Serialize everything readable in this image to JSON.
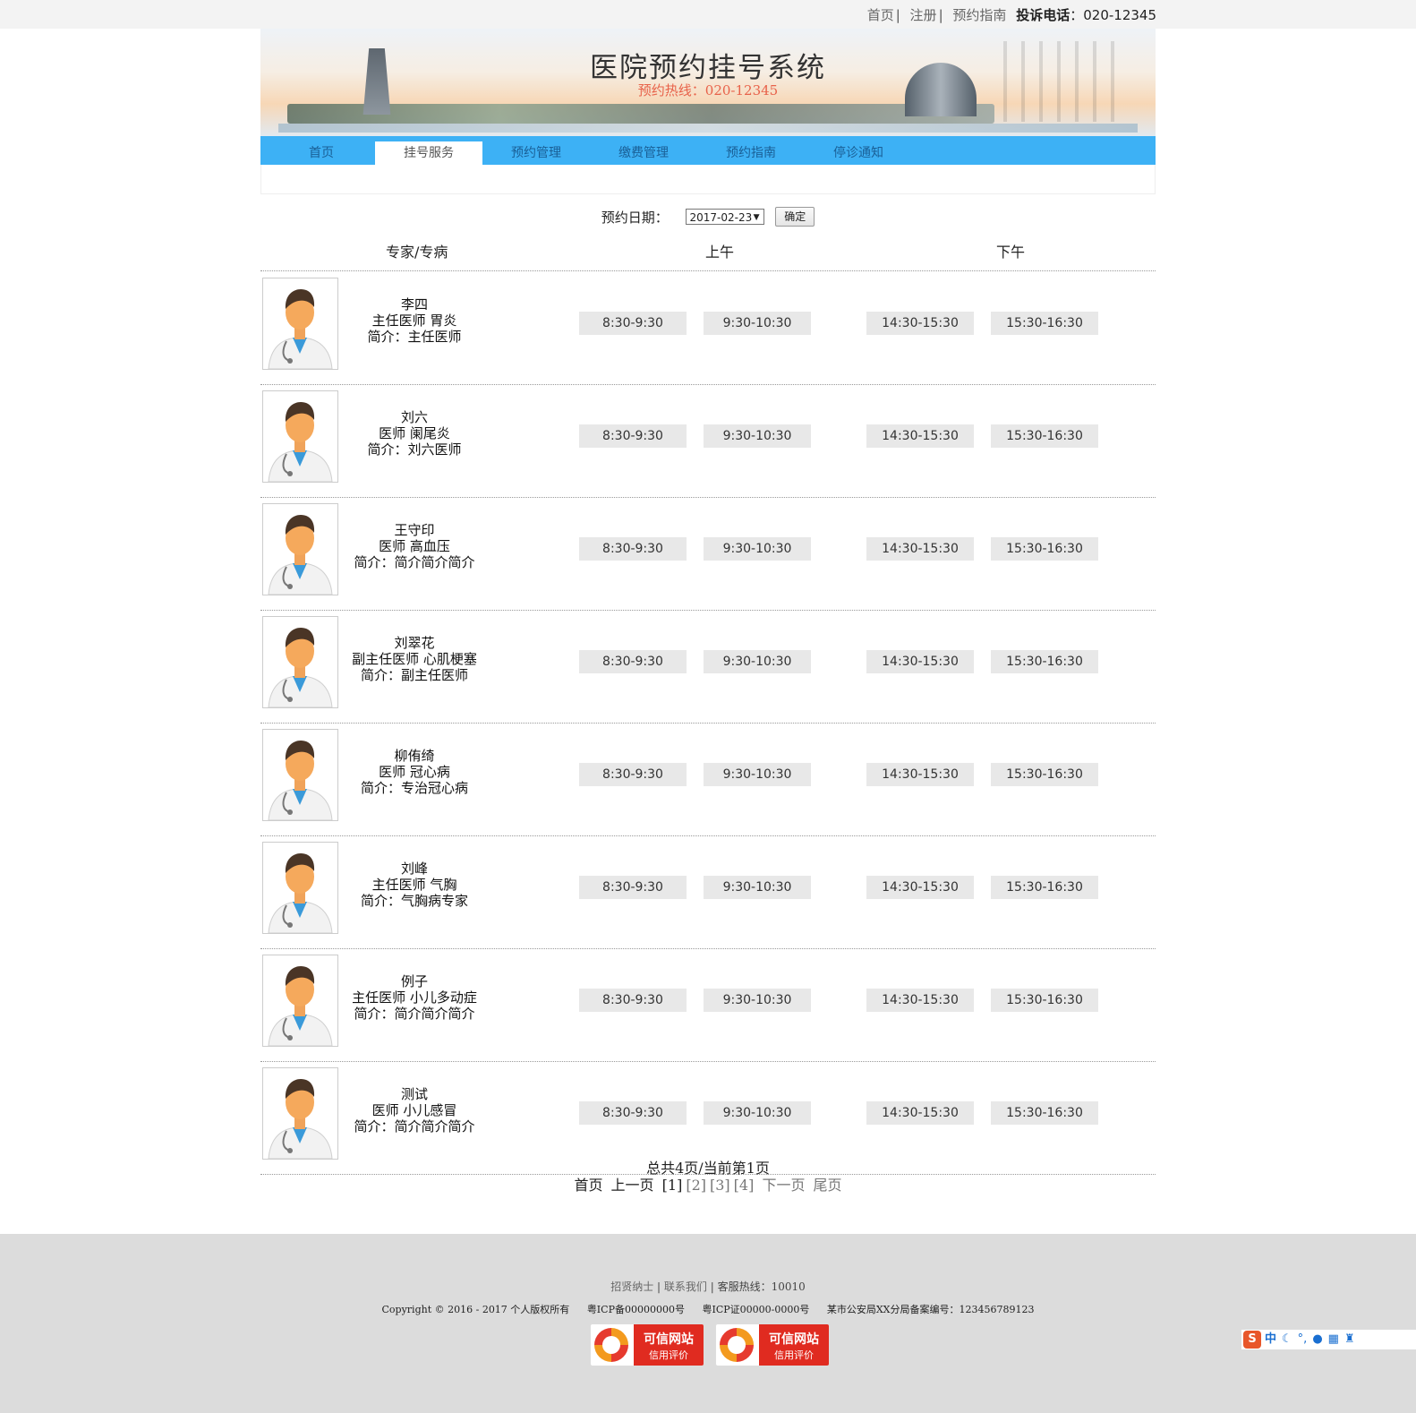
{
  "top_links": {
    "home": "首页",
    "register": "注册",
    "guide": "预约指南",
    "complaint_label": "投诉电话",
    "complaint_phone": "020-12345"
  },
  "banner": {
    "title": "医院预约挂号系统",
    "hotline": "预约热线：020-12345"
  },
  "nav": {
    "tabs": [
      {
        "label": "首页",
        "active": false
      },
      {
        "label": "挂号服务",
        "active": true
      },
      {
        "label": "预约管理",
        "active": false
      },
      {
        "label": "缴费管理",
        "active": false
      },
      {
        "label": "预约指南",
        "active": false
      },
      {
        "label": "停诊通知",
        "active": false
      }
    ]
  },
  "date_filter": {
    "label": "预约日期：",
    "selected": "2017-02-23",
    "confirm": "确定"
  },
  "table_header": {
    "expert": "专家/专病",
    "morning": "上午",
    "afternoon": "下午"
  },
  "slots": [
    "8:30-9:30",
    "9:30-10:30",
    "14:30-15:30",
    "15:30-16:30"
  ],
  "doctors": [
    {
      "name": "李四",
      "title_line": "主任医师  胃炎",
      "intro": "简介：主任医师"
    },
    {
      "name": "刘六",
      "title_line": "医师  阑尾炎",
      "intro": "简介：刘六医师"
    },
    {
      "name": "王守印",
      "title_line": "医师  高血压",
      "intro": "简介：简介简介简介"
    },
    {
      "name": "刘翠花",
      "title_line": "副主任医师  心肌梗塞",
      "intro": "简介：副主任医师"
    },
    {
      "name": "柳侑绮",
      "title_line": "医师  冠心病",
      "intro": "简介：专治冠心病"
    },
    {
      "name": "刘峰",
      "title_line": "主任医师  气胸",
      "intro": "简介：气胸病专家"
    },
    {
      "name": "例子",
      "title_line": "主任医师  小儿多动症",
      "intro": "简介：简介简介简介"
    },
    {
      "name": "测试",
      "title_line": "医师  小儿感冒",
      "intro": "简介：简介简介简介"
    }
  ],
  "pager": {
    "summary": "总共4页/当前第1页",
    "first": "首页",
    "prev": "上一页",
    "pages": [
      "[1]",
      "[2]",
      "[3]",
      "[4]"
    ],
    "next": "下一页",
    "last": "尾页"
  },
  "footer": {
    "link1": "招贤纳士",
    "link2": "联系我们",
    "service": "客服热线：10010",
    "copyright": "Copyright © 2016 - 2017 个人版权所有",
    "icp1": "粤ICP备00000000号",
    "icp2": "粤ICP证00000-0000号",
    "police": "某市公安局XX分局备案编号：123456789123",
    "badge_title": "可信网站",
    "badge_sub": "信用评价"
  },
  "ime": {
    "mode": "中"
  }
}
